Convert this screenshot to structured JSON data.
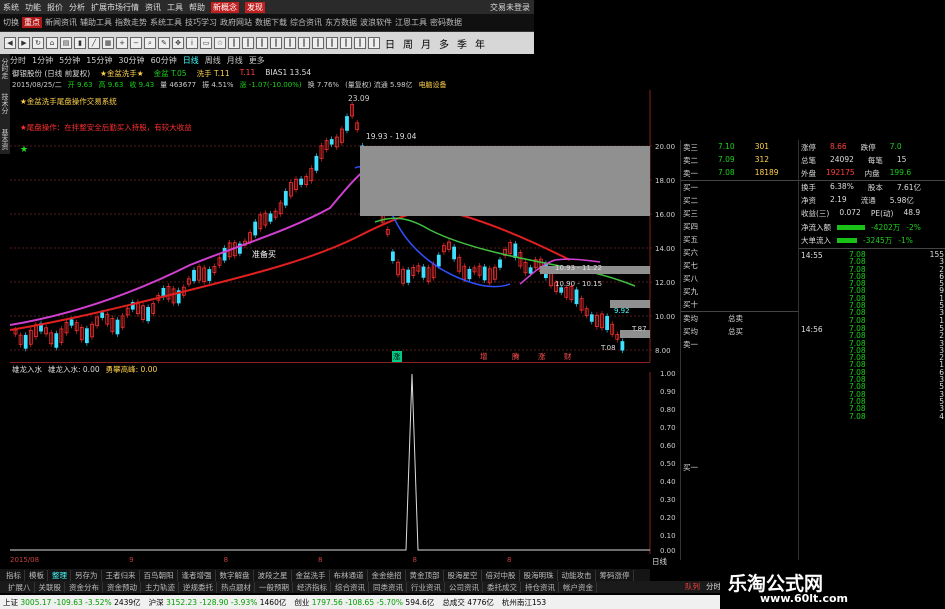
{
  "menubar": {
    "items": [
      "系统",
      "功能",
      "报价",
      "分析",
      "扩展市场行情",
      "资讯",
      "工具",
      "帮助"
    ],
    "tab_red1": "新概念",
    "tab_red2": "发现",
    "right_text": "交易未登录"
  },
  "tabbar": {
    "items": [
      "切换",
      "重点",
      "新闻资讯",
      "辅助工具",
      "指数走势",
      "系统工具",
      "技巧学习",
      "政府网站",
      "数据下载",
      "综合资讯",
      "东方数据",
      "波浪软件",
      "江恩工具",
      "密码数据"
    ]
  },
  "toolbar": {
    "periods": [
      "日",
      "周",
      "月",
      "多",
      "季",
      "年"
    ]
  },
  "periodbar": {
    "items": [
      "分时",
      "1分钟",
      "5分钟",
      "15分钟",
      "30分钟",
      "60分钟",
      "日线",
      "周线",
      "月线",
      "更多"
    ],
    "active": "日线"
  },
  "sidetabs": [
    "分时走势",
    "技术分析",
    "基本资料"
  ],
  "info": {
    "line1": [
      "御银股份 (日线 前复权)",
      "★金盆洗手★",
      "金盆 T.05",
      "洗手 T.11",
      "T.11",
      "BIAS1 13.54"
    ],
    "line2": [
      "2015/08/25/二",
      "开 9.63",
      "高 9.63",
      "收 9.43",
      "量 463677",
      "振 4.51%",
      "涨 -1.07(-10.00%)",
      "换 7.76%",
      "(量复权) 流通 5.98亿",
      "电脑设备"
    ]
  },
  "annotations": {
    "sys_title": "★金盆洗手尾盘操作交易系统",
    "sys_desc": "★尾盘操作：在拌整安全后勤买入持股，有较大收益",
    "star": "★",
    "peak": "23.09",
    "range": "19.93 - 19.04",
    "buy_signal": "准备买",
    "mid1": "10.93 - 11.22",
    "mid2": "10.90 - 10.15",
    "low1": "9.92",
    "low2": "T.87",
    "low3": "T.08"
  },
  "price_ticks": [
    "20.00",
    "18.00",
    "16.00",
    "14.00",
    "12.00",
    "10.00",
    "8.00"
  ],
  "indicator": {
    "title": "雄龙入水",
    "label": "雄龙入水: 0.00",
    "label2": "勇攀高峰: 0.00",
    "ticks": [
      "1.00",
      "0.90",
      "0.80",
      "0.70",
      "0.60",
      "0.50",
      "0.40",
      "0.30",
      "0.20",
      "0.10",
      "0.00"
    ]
  },
  "chart_markers": [
    "涨",
    "增",
    "腾",
    "涨",
    "财"
  ],
  "date_axis": [
    "2015/08",
    "9",
    "8",
    "8",
    "8",
    "8"
  ],
  "orderbook": {
    "asks": [
      [
        "卖三",
        "7.10",
        "301"
      ],
      [
        "卖二",
        "7.09",
        "312"
      ],
      [
        "卖一",
        "7.08",
        "18189"
      ]
    ],
    "bids": [
      "买一",
      "买二",
      "买三",
      "买四",
      "买五",
      "买六",
      "买七",
      "买八",
      "买九",
      "买十"
    ],
    "avg_sell": "卖均",
    "avg_buy": "买均",
    "total_sell": "总卖",
    "total_buy": "总买",
    "last": "卖一"
  },
  "quote": {
    "rows": [
      [
        "涨停",
        "8.66",
        "跌停",
        "7.0"
      ],
      [
        "总笔",
        "24092",
        "每笔",
        "15"
      ],
      [
        "外盘",
        "192175",
        "内盘",
        "199.6"
      ],
      [
        "换手",
        "6.38%",
        "股本",
        "7.61亿"
      ],
      [
        "净资",
        "2.19",
        "流通",
        "5.98亿"
      ],
      [
        "收益(三)",
        "0.072",
        "PE(动)",
        "48.9"
      ]
    ],
    "inflow": [
      [
        "净流入额",
        "-4202万",
        "-2%"
      ],
      [
        "大单流入",
        "-3245万",
        "-1%"
      ]
    ]
  },
  "ticks": {
    "time1": "14:55",
    "time2": "14:56",
    "rows1": [
      [
        "7.08",
        "155"
      ],
      [
        "7.08",
        "3"
      ],
      [
        "7.08",
        "2"
      ],
      [
        "7.08",
        "6"
      ],
      [
        "7.08",
        "5"
      ],
      [
        "7.08",
        "9"
      ],
      [
        "7.08",
        "1"
      ],
      [
        "7.08",
        "5"
      ],
      [
        "7.08",
        "3"
      ],
      [
        "7.08",
        "1"
      ]
    ],
    "rows2": [
      [
        "7.08",
        "5"
      ],
      [
        "7.08",
        "2"
      ],
      [
        "7.08",
        "3"
      ],
      [
        "7.08",
        "3"
      ],
      [
        "7.08",
        "2"
      ],
      [
        "7.08",
        "1"
      ],
      [
        "7.08",
        "6"
      ],
      [
        "7.08",
        "3"
      ],
      [
        "7.08",
        "5"
      ],
      [
        "7.08",
        "3"
      ],
      [
        "7.08",
        "5"
      ],
      [
        "7.08",
        "3"
      ],
      [
        "7.08",
        "4"
      ]
    ]
  },
  "bottom_tabs": [
    "指标",
    "模板",
    "整理",
    "另存为",
    "王者归来",
    "百鸟朝阳",
    "逢者增强",
    "数字解盘",
    "波段之星",
    "金盆洗手",
    "布林通道",
    "金金绝招",
    "黄金顶部",
    "股海星空",
    "倍对中股",
    "股海明珠",
    "动能攻击",
    "筹码涨停"
  ],
  "bottom_tabs2": [
    "扩展八",
    "关联股",
    "资金分布",
    "资金预动",
    "主力轨迹",
    "逆规委托",
    "热点题材",
    "一般预期",
    "经济指标",
    "综合资讯",
    "同类资讯",
    "行业资讯",
    "公司资讯",
    "委托成交",
    "持仓资讯",
    "帐户资金"
  ],
  "right_bottom_tabs": [
    "日线",
    "队列",
    "分时",
    "龙虎"
  ],
  "statusbar": {
    "items": [
      [
        "上证",
        "3005.17",
        "-109.63",
        "-3.52%",
        "2439亿"
      ],
      [
        "沪深",
        "3152.23",
        "-128.90",
        "-3.93%",
        "1460亿"
      ],
      [
        "创业",
        "1797.56",
        "-108.65",
        "-5.70%",
        "594.6亿"
      ],
      [
        "总成交",
        "4776亿"
      ]
    ],
    "right": "杭州南江153"
  },
  "watermark": {
    "cn": "乐淘公式网",
    "url": "www.60lt.com"
  }
}
